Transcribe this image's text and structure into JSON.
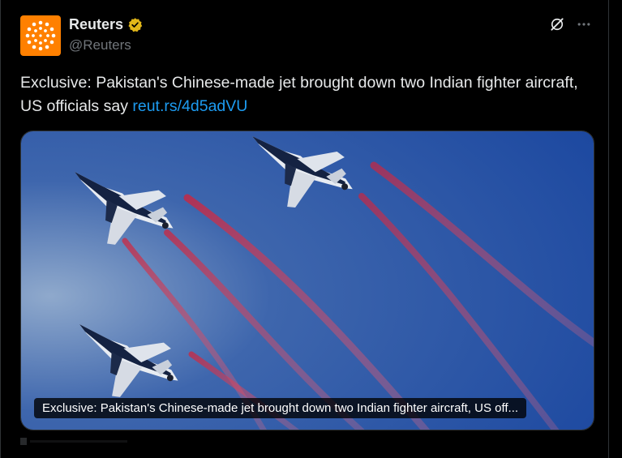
{
  "author": {
    "name": "Reuters",
    "handle": "@Reuters",
    "avatar_icon": "reuters-logo",
    "verified_icon": "verified-gold-badge",
    "colors": {
      "avatar_bg": "#ff8000",
      "verified": "#e2b719"
    }
  },
  "actions": {
    "grok_icon": "grok-icon",
    "more_icon": "more-horizontal-icon"
  },
  "tweet": {
    "text": "Exclusive: Pakistan's Chinese-made jet brought down two Indian fighter aircraft, US officials say ",
    "link": "reut.rs/4d5adVU",
    "link_color": "#1d9bf0"
  },
  "card": {
    "image": "four fighter jets flying in formation with red smoke trails against blue sky",
    "caption": "Exclusive: Pakistan's Chinese-made jet brought down two Indian fighter aircraft, US off..."
  }
}
